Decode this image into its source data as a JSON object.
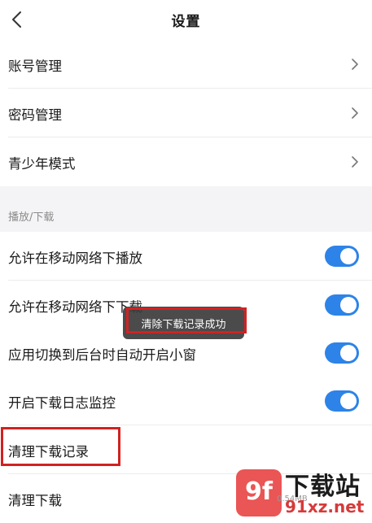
{
  "header": {
    "title": "设置"
  },
  "account_section": {
    "items": [
      {
        "label": "账号管理"
      },
      {
        "label": "密码管理"
      },
      {
        "label": "青少年模式"
      }
    ]
  },
  "playback_section": {
    "title": "播放/下载",
    "items": [
      {
        "label": "允许在移动网络下播放",
        "enabled": true
      },
      {
        "label": "允许在移动网络下下载",
        "enabled": true
      },
      {
        "label": "应用切换到后台时自动开启小窗",
        "enabled": true
      },
      {
        "label": "开启下载日志监控",
        "enabled": true
      }
    ],
    "actions": [
      {
        "label": "清理下载记录"
      },
      {
        "label": "清理下载"
      }
    ],
    "size_text": "0.54MB"
  },
  "toast": {
    "message": "清除下载记录成功"
  },
  "watermark": {
    "badge": "9f",
    "title": "下载站",
    "subtitle": "91xz.net"
  },
  "colors": {
    "toggle_on": "#2d83e8",
    "highlight": "#d22121",
    "section_bg": "#f4f4f6"
  }
}
